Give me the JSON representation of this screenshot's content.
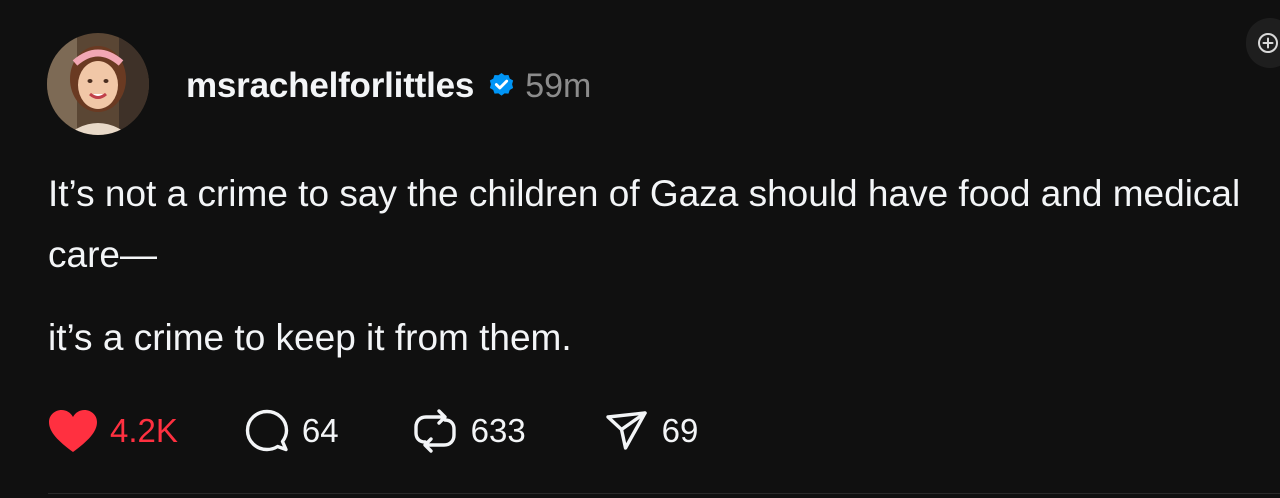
{
  "post": {
    "author": {
      "username": "msrachelforlittles",
      "verified": true,
      "avatar_icon": "profile-photo"
    },
    "timestamp": "59m",
    "body": {
      "line1": "It’s not a crime to say the children of Gaza should have food and medical care—",
      "line2": "it’s a crime to keep it from them."
    },
    "actions": {
      "likes": {
        "count": "4.2K",
        "icon": "heart-filled-icon",
        "liked": true
      },
      "replies": {
        "count": "64",
        "icon": "comment-icon"
      },
      "reposts": {
        "count": "633",
        "icon": "repost-icon"
      },
      "shares": {
        "count": "69",
        "icon": "send-icon"
      }
    }
  },
  "colors": {
    "background": "#101010",
    "text": "#f3f5f7",
    "muted": "#8c8c8c",
    "like_red": "#ff3040",
    "verified_blue": "#0095f6"
  }
}
